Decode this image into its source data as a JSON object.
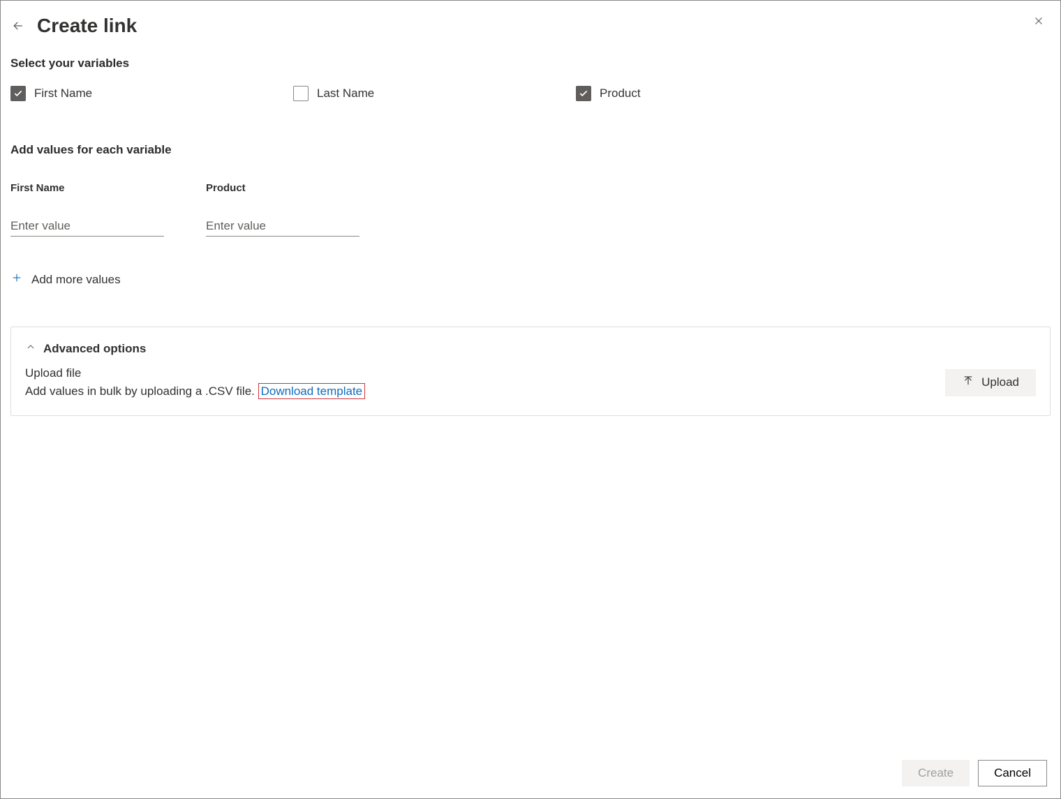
{
  "header": {
    "title": "Create link"
  },
  "sections": {
    "select_variables_label": "Select your variables",
    "add_values_label": "Add values for each variable",
    "advanced_label": "Advanced options"
  },
  "checkboxes": [
    {
      "label": "First Name",
      "checked": true
    },
    {
      "label": "Last Name",
      "checked": false
    },
    {
      "label": "Product",
      "checked": true
    }
  ],
  "fields": [
    {
      "label": "First Name",
      "placeholder": "Enter value"
    },
    {
      "label": "Product",
      "placeholder": "Enter value"
    }
  ],
  "add_more_label": "Add more values",
  "advanced": {
    "upload_file_label": "Upload file",
    "instruction_prefix": "Add values in bulk by uploading a .CSV file. ",
    "download_link": "Download template",
    "upload_button": "Upload"
  },
  "footer": {
    "create": "Create",
    "cancel": "Cancel"
  }
}
